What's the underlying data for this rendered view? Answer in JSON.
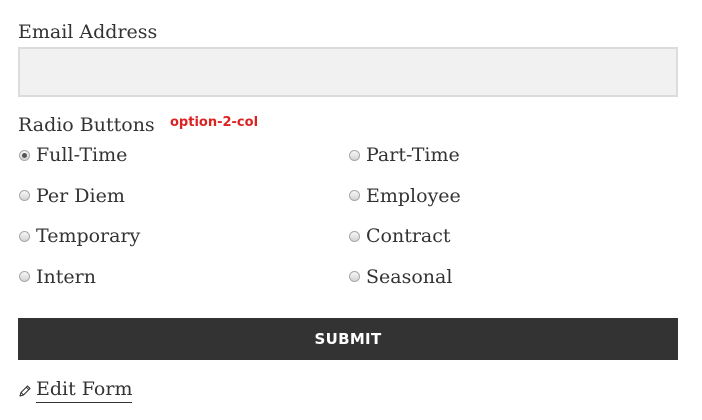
{
  "email": {
    "label": "Email Address",
    "value": "",
    "placeholder": ""
  },
  "radio_group": {
    "label": "Radio Buttons",
    "note": "option-2-col",
    "options": [
      {
        "label": "Full-Time",
        "checked": true
      },
      {
        "label": "Part-Time",
        "checked": false
      },
      {
        "label": "Per Diem",
        "checked": false
      },
      {
        "label": "Employee",
        "checked": false
      },
      {
        "label": "Temporary",
        "checked": false
      },
      {
        "label": "Contract",
        "checked": false
      },
      {
        "label": "Intern",
        "checked": false
      },
      {
        "label": "Seasonal",
        "checked": false
      }
    ]
  },
  "submit": {
    "label": "SUBMIT"
  },
  "edit_form": {
    "label": "Edit Form",
    "icon": "pencil-icon"
  },
  "colors": {
    "note": "#dd2222",
    "button_bg": "#333333",
    "input_bg": "#f1f1f1"
  }
}
